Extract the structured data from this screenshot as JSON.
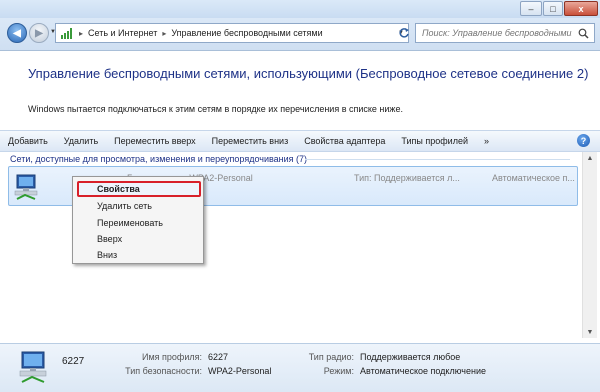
{
  "window": {
    "minimize_glyph": "–",
    "maximize_glyph": "□",
    "close_glyph": "x"
  },
  "address_bar": {
    "breadcrumb": [
      "Сеть и Интернет",
      "Управление беспроводными сетями"
    ],
    "search_placeholder": "Поиск: Управление беспроводными..."
  },
  "page": {
    "title": "Управление беспроводными сетями, использующими (Беспроводное сетевое соединение 2)",
    "info": "Windows пытается подключаться к этим сетям в порядке их перечисления в списке ниже."
  },
  "toolbar": {
    "items": [
      "Добавить",
      "Удалить",
      "Переместить вверх",
      "Переместить вниз",
      "Свойства адаптера",
      "Типы профилей",
      "»"
    ],
    "help_glyph": "?"
  },
  "network_list": {
    "group_header": "Сети, доступные для просмотра, изменения и переупорядочивания (7)",
    "rows": [
      {
        "security": "Безопасность: WPA2-Personal",
        "type": "Тип: Поддерживается л...",
        "mode": "Автоматическое п..."
      }
    ]
  },
  "context_menu": {
    "items": [
      "Свойства",
      "Удалить сеть",
      "Переименовать",
      "Вверх",
      "Вниз"
    ],
    "highlighted": "Свойства"
  },
  "details": {
    "name": "6227",
    "profile_name_label": "Имя профиля:",
    "profile_name_value": "6227",
    "security_type_label": "Тип безопасности:",
    "security_type_value": "WPA2-Personal",
    "radio_type_label": "Тип радио:",
    "radio_type_value": "Поддерживается любое",
    "mode_label": "Режим:",
    "mode_value": "Автоматическое подключение"
  },
  "colors": {
    "title_text": "#1e3287",
    "highlight_border": "#d8202a",
    "selection_bg": "#d9e9fb"
  }
}
